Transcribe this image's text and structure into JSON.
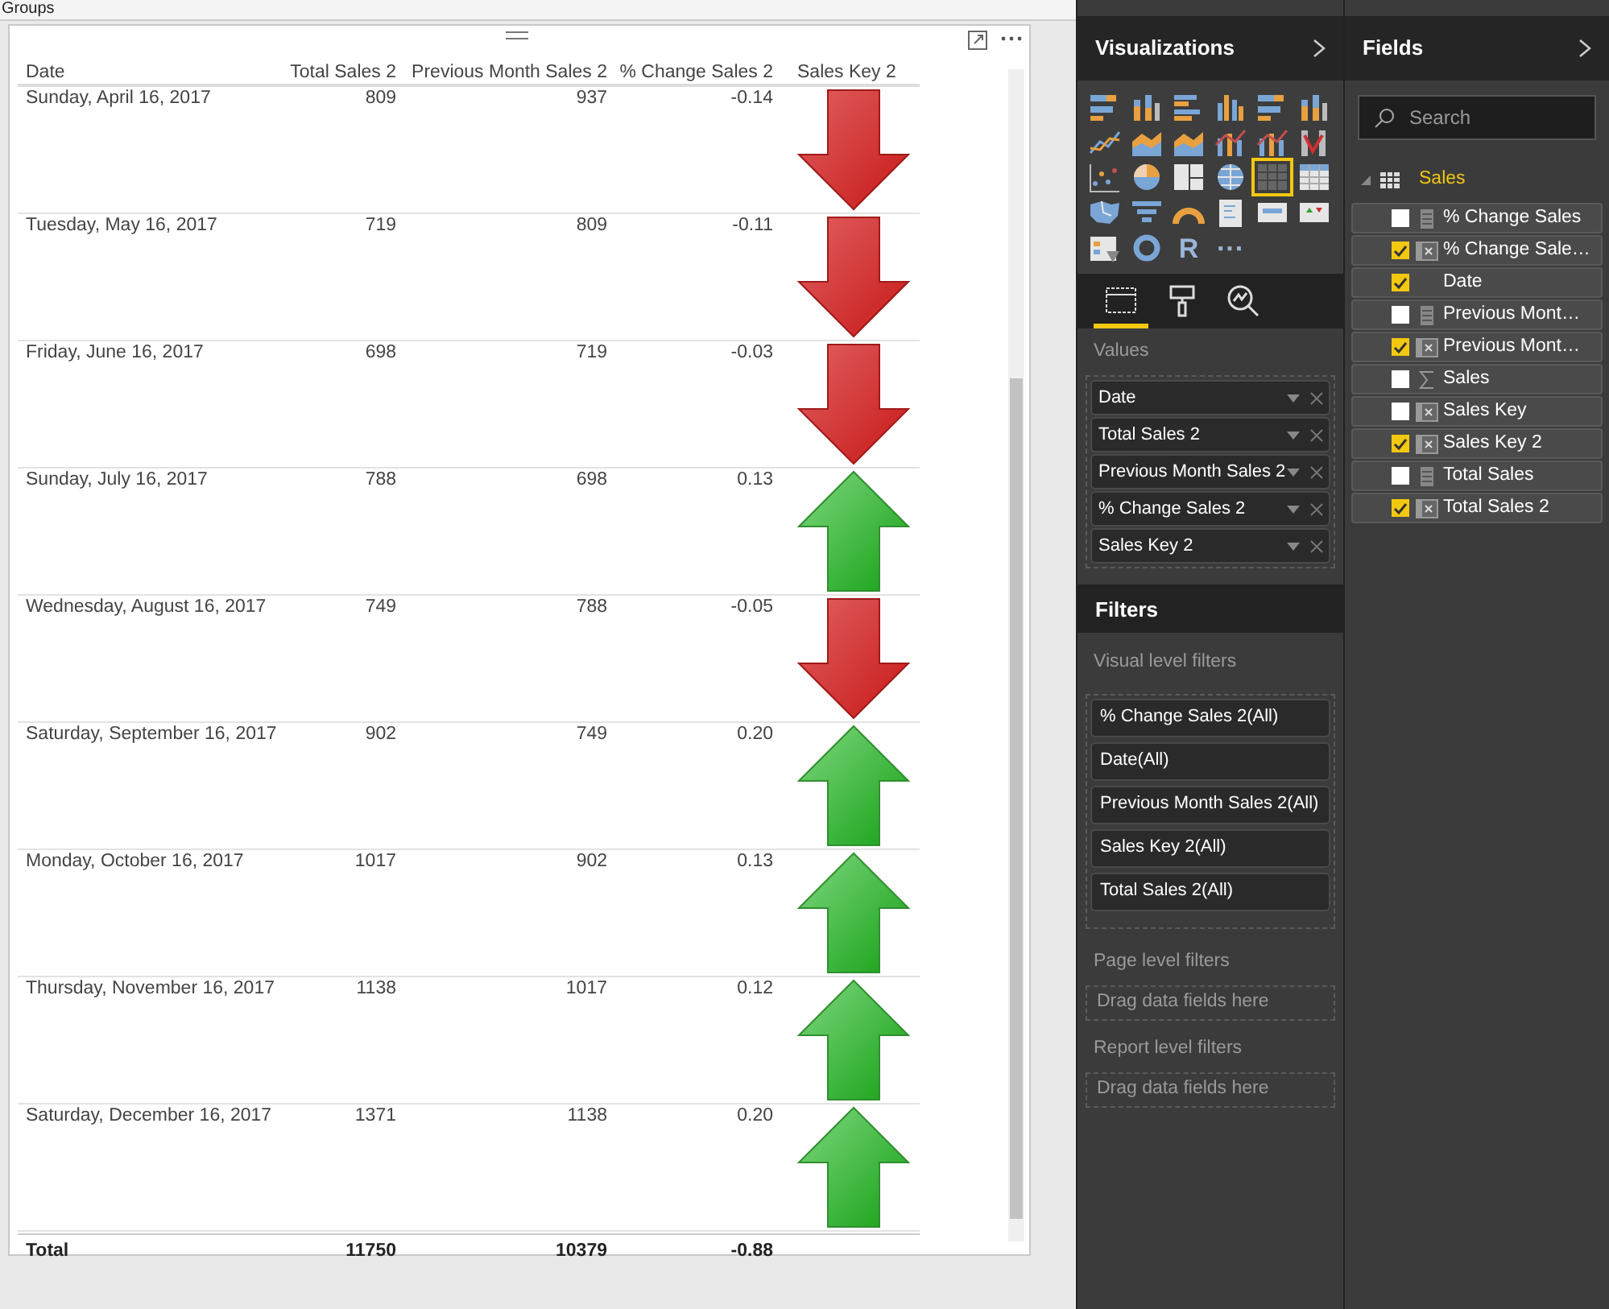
{
  "top_bar": {
    "label": "Groups"
  },
  "table": {
    "columns": [
      "Date",
      "Total Sales 2",
      "Previous Month Sales 2",
      "% Change Sales 2",
      "Sales Key 2"
    ],
    "rows": [
      {
        "date": "Sunday, April 16, 2017",
        "total": "809",
        "previous": "937",
        "change": "-0.14",
        "kind": "down"
      },
      {
        "date": "Tuesday, May 16, 2017",
        "total": "719",
        "previous": "809",
        "change": "-0.11",
        "kind": "down"
      },
      {
        "date": "Friday, June 16, 2017",
        "total": "698",
        "previous": "719",
        "change": "-0.03",
        "kind": "down"
      },
      {
        "date": "Sunday, July 16, 2017",
        "total": "788",
        "previous": "698",
        "change": "0.13",
        "kind": "up"
      },
      {
        "date": "Wednesday, August 16, 2017",
        "total": "749",
        "previous": "788",
        "change": "-0.05",
        "kind": "down"
      },
      {
        "date": "Saturday, September 16, 2017",
        "total": "902",
        "previous": "749",
        "change": "0.20",
        "kind": "up"
      },
      {
        "date": "Monday, October 16, 2017",
        "total": "1017",
        "previous": "902",
        "change": "0.13",
        "kind": "up"
      },
      {
        "date": "Thursday, November 16, 2017",
        "total": "1138",
        "previous": "1017",
        "change": "0.12",
        "kind": "up"
      },
      {
        "date": "Saturday, December 16, 2017",
        "total": "1371",
        "previous": "1138",
        "change": "0.20",
        "kind": "up"
      }
    ],
    "total": {
      "label": "Total",
      "total": "11750",
      "previous": "10379",
      "change": "-0.88"
    }
  },
  "visualizations": {
    "title": "Visualizations",
    "gallery": [
      {
        "kind": "stacked-bar",
        "selected": false
      },
      {
        "kind": "stacked-column",
        "selected": false
      },
      {
        "kind": "clustered-bar",
        "selected": false
      },
      {
        "kind": "clustered-column",
        "selected": false
      },
      {
        "kind": "stacked-bar",
        "selected": false
      },
      {
        "kind": "stacked-column",
        "selected": false
      },
      {
        "kind": "line",
        "selected": false
      },
      {
        "kind": "area",
        "selected": false
      },
      {
        "kind": "area",
        "selected": false
      },
      {
        "kind": "combo",
        "selected": false
      },
      {
        "kind": "combo",
        "selected": false
      },
      {
        "kind": "ribbon",
        "selected": false
      },
      {
        "kind": "scatter",
        "selected": false
      },
      {
        "kind": "pie",
        "selected": false
      },
      {
        "kind": "treemap",
        "selected": false
      },
      {
        "kind": "globe",
        "selected": false
      },
      {
        "kind": "table",
        "selected": true
      },
      {
        "kind": "matrix",
        "selected": false
      },
      {
        "kind": "filled-map",
        "selected": false
      },
      {
        "kind": "funnel",
        "selected": false
      },
      {
        "kind": "gauge",
        "selected": false
      },
      {
        "kind": "multi-card",
        "selected": false
      },
      {
        "kind": "card",
        "selected": false
      },
      {
        "kind": "kpi",
        "selected": false
      },
      {
        "kind": "slicer",
        "selected": false
      },
      {
        "kind": "donut",
        "selected": false
      },
      {
        "kind": "text",
        "label": "R",
        "selected": false
      },
      {
        "kind": "text",
        "label": "···",
        "selected": false
      }
    ],
    "tabs": [
      {
        "kind": "fields",
        "selected": true
      },
      {
        "kind": "format",
        "selected": false
      },
      {
        "kind": "analytics",
        "selected": false
      }
    ],
    "values_label": "Values",
    "values": [
      "Date",
      "Total Sales 2",
      "Previous Month Sales 2",
      "% Change Sales 2",
      "Sales Key 2"
    ]
  },
  "filters": {
    "title": "Filters",
    "visual_label": "Visual level filters",
    "visual": [
      "% Change Sales 2(All)",
      "Date(All)",
      "Previous Month Sales 2(All)",
      "Sales Key 2(All)",
      "Total Sales 2(All)"
    ],
    "page_label": "Page level filters",
    "page_drop": "Drag data fields here",
    "report_label": "Report level filters",
    "report_drop": "Drag data fields here"
  },
  "fields": {
    "title": "Fields",
    "search": {
      "placeholder": "Search"
    },
    "table": "Sales",
    "items": [
      {
        "label": "% Change Sales",
        "checked": false,
        "kind": "measure"
      },
      {
        "label": "% Change Sale…",
        "checked": true,
        "kind": "column"
      },
      {
        "label": "Date",
        "checked": true,
        "kind": "none"
      },
      {
        "label": "Previous Mont…",
        "checked": false,
        "kind": "measure"
      },
      {
        "label": "Previous Mont…",
        "checked": true,
        "kind": "column"
      },
      {
        "label": "Sales",
        "checked": false,
        "kind": "sum"
      },
      {
        "label": "Sales Key",
        "checked": false,
        "kind": "column"
      },
      {
        "label": "Sales Key 2",
        "checked": true,
        "kind": "column"
      },
      {
        "label": "Total Sales",
        "checked": false,
        "kind": "measure"
      },
      {
        "label": "Total Sales 2",
        "checked": true,
        "kind": "column"
      }
    ]
  }
}
